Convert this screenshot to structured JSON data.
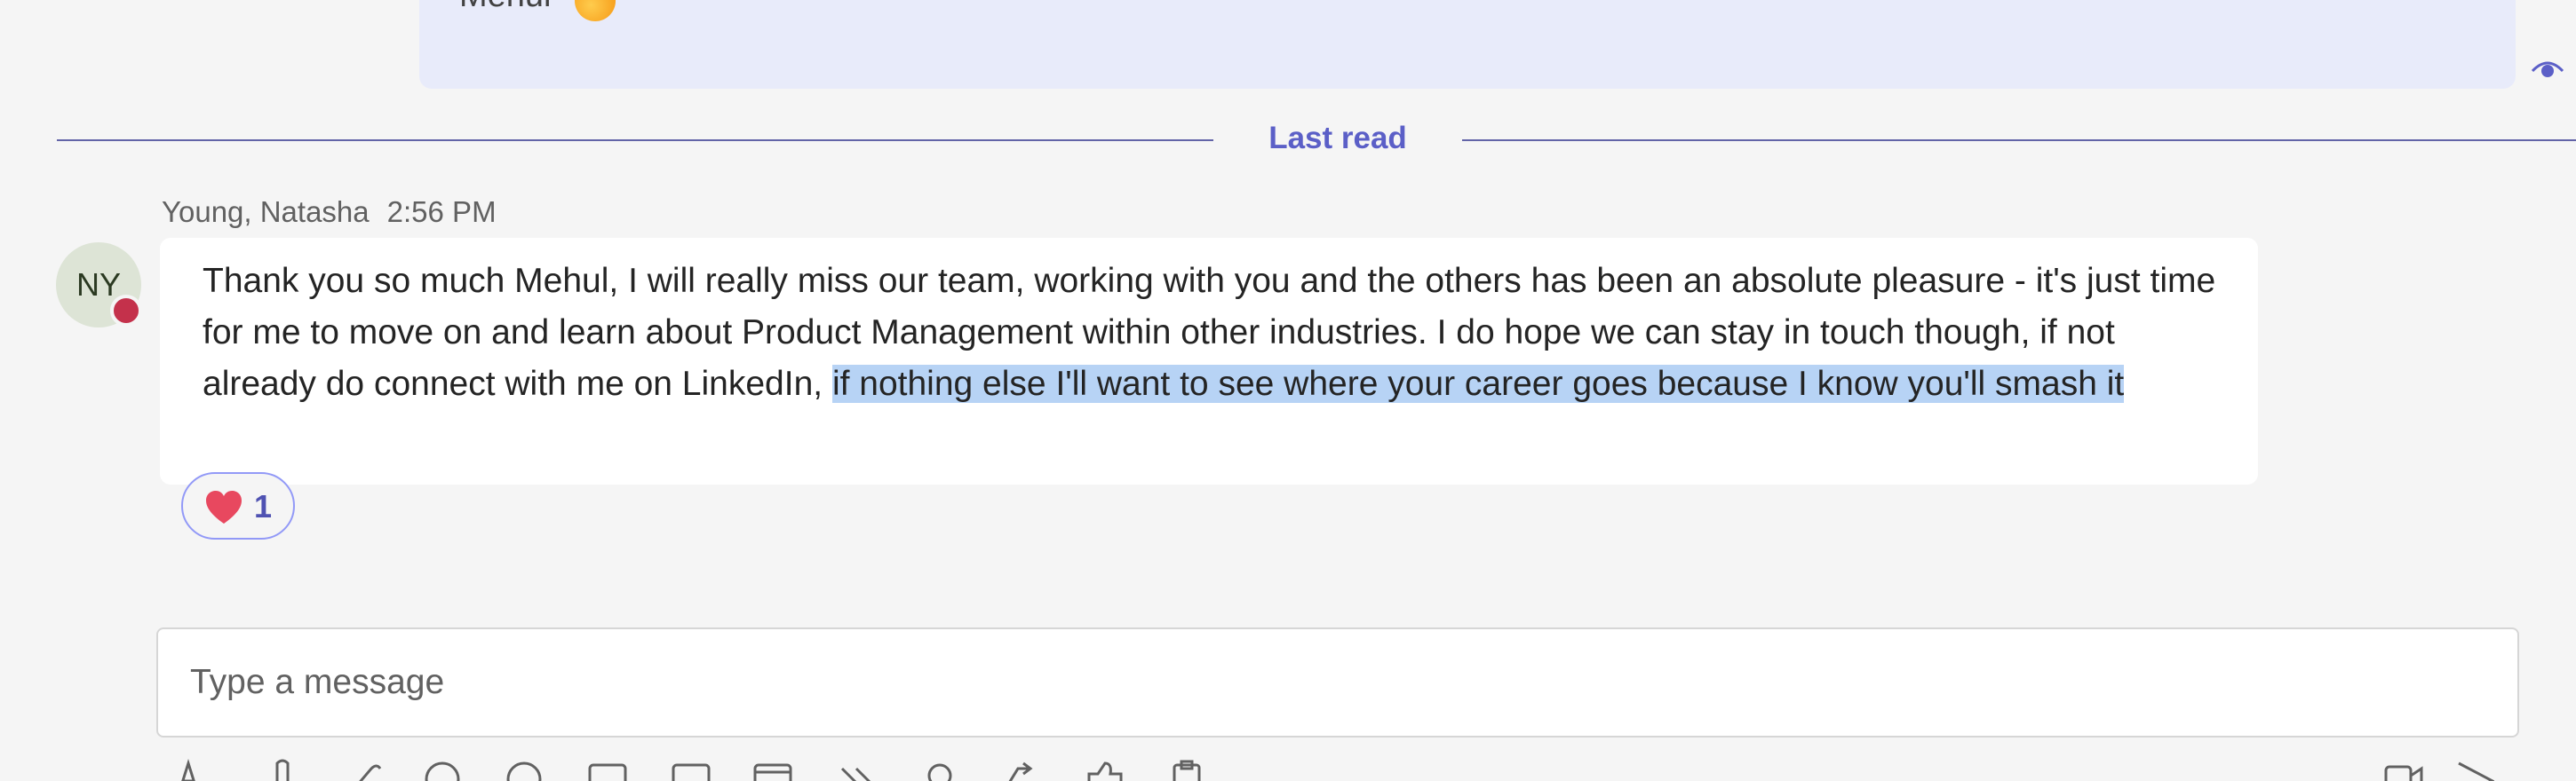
{
  "previous_message": {
    "sender_name_partial": "Mehul",
    "emoji_icon": "grinning-face-icon"
  },
  "divider": {
    "label": "Last read"
  },
  "message": {
    "sender": "Young, Natasha",
    "time": "2:56 PM",
    "avatar_initials": "NY",
    "presence": "busy",
    "text_plain": "Thank you so much Mehul, I will really miss our team, working with you and the others has been an absolute pleasure - it's just time for me to move on and learn about Product Management within other industries. I do hope we can stay in touch though, if not already do connect with me on LinkedIn, ",
    "text_highlighted": "if nothing else I'll want to see where your career goes because I know you'll smash it",
    "reaction": {
      "emoji": "heart-icon",
      "count": "1"
    }
  },
  "compose": {
    "placeholder": "Type a message"
  },
  "toolbar_icons": [
    "format-icon",
    "attach-icon",
    "loop-icon",
    "emoji-icon",
    "gif-icon",
    "sticker-icon",
    "meet-now-icon",
    "schedule-icon",
    "praise-icon",
    "location-icon",
    "approvals-icon",
    "like-icon",
    "clipboard-icon",
    "video-icon",
    "send-icon"
  ],
  "colors": {
    "accent": "#5b5fc7",
    "highlight": "#b7d3f5",
    "busy": "#c4314b",
    "prev_bubble": "#e8ebfa"
  }
}
